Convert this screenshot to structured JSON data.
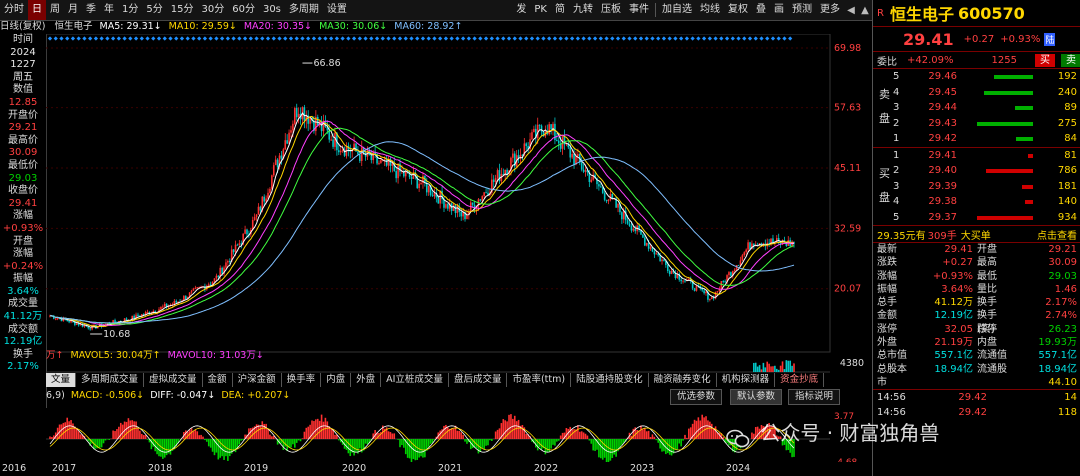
{
  "toolbar": {
    "items": [
      "分时",
      "日",
      "周",
      "月",
      "季",
      "年",
      "1分",
      "5分",
      "15分",
      "30分",
      "60分",
      "30s",
      "多周期",
      "设置"
    ],
    "active": "日",
    "right_items": [
      "发",
      "PK",
      "简",
      "九转",
      "压板",
      "事件",
      "加自选",
      "均线",
      "复权",
      "叠",
      "画",
      "预测",
      "更多"
    ]
  },
  "ma_line": {
    "prefix": "日线(复权)",
    "stock": "恒生电子",
    "ma5": "MA5: 29.31↓",
    "ma10": "MA10: 29.59↓",
    "ma20": "MA20: 30.35↓",
    "ma30": "MA30: 30.06↓",
    "ma60": "MA60: 28.92↑"
  },
  "left_info": [
    {
      "t": "时间",
      "c": "lbl"
    },
    {
      "t": "2024",
      "c": "wht"
    },
    {
      "t": "1227",
      "c": "wht"
    },
    {
      "t": "周五",
      "c": "wht"
    },
    {
      "t": "数值",
      "c": "lbl"
    },
    {
      "t": "12.85",
      "c": "red"
    },
    {
      "t": "开盘价",
      "c": "lbl"
    },
    {
      "t": "29.21",
      "c": "red"
    },
    {
      "t": "最高价",
      "c": "lbl"
    },
    {
      "t": "30.09",
      "c": "red"
    },
    {
      "t": "最低价",
      "c": "lbl"
    },
    {
      "t": "29.03",
      "c": "grn"
    },
    {
      "t": "收盘价",
      "c": "lbl"
    },
    {
      "t": "29.41",
      "c": "red"
    },
    {
      "t": "涨幅",
      "c": "lbl"
    },
    {
      "t": "+0.93%",
      "c": "red"
    },
    {
      "t": "开盘",
      "c": "lbl"
    },
    {
      "t": "涨幅",
      "c": "lbl"
    },
    {
      "t": "+0.24%",
      "c": "red"
    },
    {
      "t": "振幅",
      "c": "lbl"
    },
    {
      "t": "3.64%",
      "c": "cyn"
    },
    {
      "t": "成交量",
      "c": "lbl"
    },
    {
      "t": "41.12万",
      "c": "cyn"
    },
    {
      "t": "成交额",
      "c": "lbl"
    },
    {
      "t": "12.19亿",
      "c": "cyn"
    },
    {
      "t": "换手",
      "c": "lbl"
    },
    {
      "t": "2.17%",
      "c": "cyn"
    }
  ],
  "price_axis": [
    "69.98",
    "57.63",
    "45.11",
    "32.59",
    "20.07"
  ],
  "chart_annotations": {
    "high": "66.86",
    "low": "10.68"
  },
  "chart_data": {
    "type": "line",
    "title": "",
    "x": [
      "2016",
      "2017",
      "2018",
      "2019",
      "2020",
      "2021",
      "2022",
      "2023",
      "2024"
    ],
    "series": [
      {
        "values": [
          14.5,
          12.0,
          14.0,
          17.0,
          22.0,
          35.0,
          58.0,
          50.0,
          46.0,
          42.0,
          35.0,
          45.0,
          54.0,
          44.0,
          34.0,
          24.0,
          18.0,
          30.0,
          29.41
        ]
      }
    ],
    "ylim": [
      10.68,
      69.98
    ],
    "macd": {
      "diff": -0.047,
      "dea": 0.207,
      "macd": -0.506
    }
  },
  "volume_line": {
    "v1": "万↑",
    "v2": "MAVOL5: 30.04万↑",
    "v3": "MAVOL10: 31.03万↓",
    "axis": "4380"
  },
  "tabs": [
    "文量",
    "多周期成交量",
    "虚拟成交量",
    "金额",
    "沪深金额",
    "换手率",
    "内盘",
    "外盘",
    "AI立桩成交量",
    "盘后成交量",
    "市盈率(ttm)",
    "陆股通持股变化",
    "融资融券变化",
    "机构探测器",
    "资金抄底"
  ],
  "active_tab": "文量",
  "macd_line": {
    "params": "6,9)",
    "macd": "MACD: -0.506↓",
    "diff": "DIFF: -0.047↓",
    "dea": "DEA: +0.207↓",
    "b1": "优选参数",
    "b2": "默认参数",
    "b3": "指标说明",
    "axis_top": "3.77",
    "axis_bot": "-4.68"
  },
  "years": [
    "2016",
    "2017",
    "2018",
    "2019",
    "2020",
    "2021",
    "2022",
    "2023",
    "2024"
  ],
  "right": {
    "badge": "R",
    "name": "恒生电子",
    "code": "600570",
    "price": "29.41",
    "change": "+0.27",
    "pct": "+0.93%",
    "tag": "陆",
    "weibi_label": "委比",
    "weibi": "+42.09%",
    "weicha": "1255",
    "buy": "买",
    "sell": "卖",
    "sell_label": [
      "卖",
      "盘"
    ],
    "buy_label": [
      "买",
      "盘"
    ],
    "asks": [
      {
        "n": "5",
        "p": "29.46",
        "v": "192"
      },
      {
        "n": "4",
        "p": "29.45",
        "v": "240"
      },
      {
        "n": "3",
        "p": "29.44",
        "v": "89"
      },
      {
        "n": "2",
        "p": "29.43",
        "v": "275"
      },
      {
        "n": "1",
        "p": "29.42",
        "v": "84"
      }
    ],
    "bids": [
      {
        "n": "1",
        "p": "29.41",
        "v": "81"
      },
      {
        "n": "2",
        "p": "29.40",
        "v": "786"
      },
      {
        "n": "3",
        "p": "29.39",
        "v": "181"
      },
      {
        "n": "4",
        "p": "29.38",
        "v": "140"
      },
      {
        "n": "5",
        "p": "29.37",
        "v": "934"
      }
    ],
    "bigorder": {
      "a": "29.35元有",
      "b": "309手",
      "c": "大买单",
      "d": "点击查看"
    },
    "stats": [
      [
        "最新",
        "29.41",
        "开盘",
        "29.21"
      ],
      [
        "涨跌",
        "+0.27",
        "最高",
        "30.09"
      ],
      [
        "涨幅",
        "+0.93%",
        "最低",
        "29.03"
      ],
      [
        "振幅",
        "3.64%",
        "量比",
        "1.46"
      ],
      [
        "总手",
        "41.12万",
        "换手",
        "2.17%"
      ],
      [
        "金额",
        "12.19亿",
        "换手(实)",
        "2.74%"
      ],
      [
        "涨停",
        "32.05",
        "跌停",
        "26.23"
      ],
      [
        "外盘",
        "21.19万",
        "内盘",
        "19.93万"
      ],
      [
        "总市值",
        "557.1亿",
        "流通值",
        "557.1亿"
      ],
      [
        "总股本",
        "18.94亿",
        "流通股",
        "18.94亿"
      ],
      [
        "市",
        "",
        "",
        "44.10"
      ]
    ],
    "ticks": [
      {
        "t": "14:56",
        "p": "29.42",
        "v": "14"
      },
      {
        "t": "14:56",
        "p": "29.42",
        "v": "118"
      }
    ]
  },
  "watermark": "公众号 · 财富独角兽"
}
